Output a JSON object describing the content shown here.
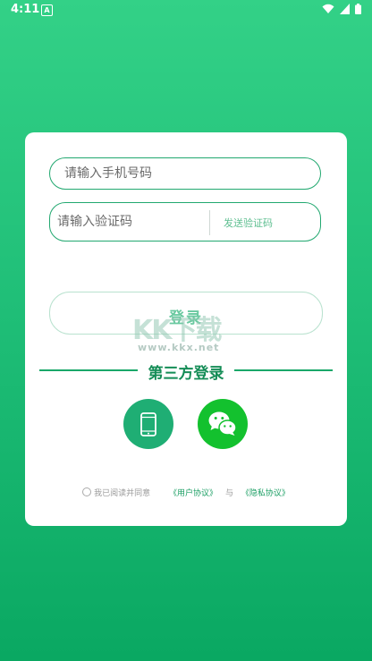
{
  "status": {
    "time": "4:11",
    "a_icon": "A"
  },
  "login": {
    "phone_placeholder": "请输入手机号码",
    "code_placeholder": "请输入验证码",
    "send_code": "发送验证码",
    "login_button": "登录"
  },
  "third_party": {
    "title": "第三方登录"
  },
  "agreement": {
    "prefix": "我已阅读并同意",
    "user_agreement": "《用户协议》",
    "and": "与",
    "privacy": "《隐私协议》"
  },
  "watermark": {
    "logo": "KK下载",
    "site": "www.kkx.net"
  },
  "colors": {
    "brand_green": "#22a870",
    "wechat_green": "#13c12e"
  }
}
